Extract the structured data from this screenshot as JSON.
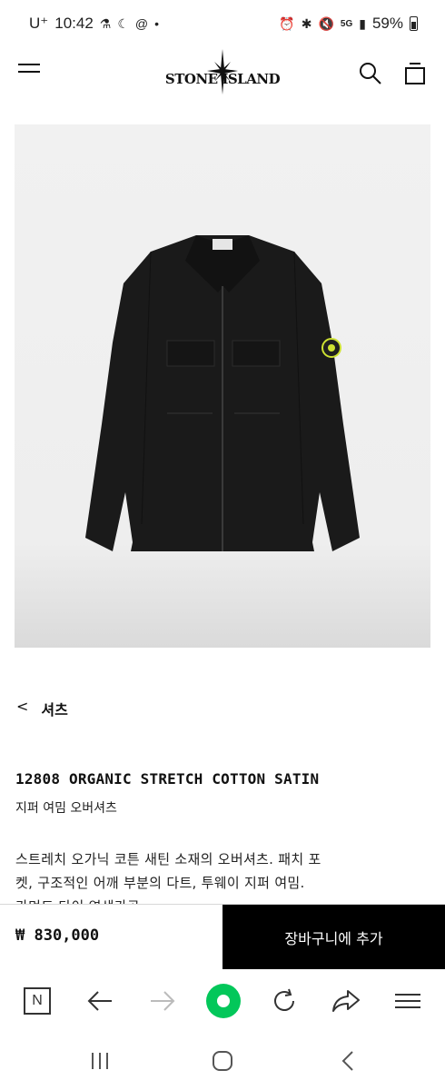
{
  "status_bar": {
    "carrier": "U⁺",
    "time": "10:42",
    "battery": "59%",
    "network": "5G",
    "left_icons": [
      "app-notification-icon",
      "moon-icon",
      "threads-icon",
      "dot-icon"
    ],
    "right_icons": [
      "alarm-icon",
      "bluetooth-icon",
      "mute-icon",
      "signal-icon",
      "battery-icon"
    ]
  },
  "header": {
    "logo_text": "STONE ISLAND",
    "icons": [
      "menu-icon",
      "stone-island-star-logo",
      "search-icon",
      "shopping-bag-icon"
    ]
  },
  "product": {
    "image_alt_icon": "black-overshirt-image",
    "breadcrumb_arrow": "<",
    "breadcrumb_label": "셔츠",
    "title": "12808 ORGANIC STRETCH COTTON SATIN",
    "subtitle": "지퍼 여밈 오버셔츠",
    "description_line1": "스트레치 오가닉 코튼 새틴 소재의 오버셔츠. 패치 포",
    "description_line2": "켓, 구조적인 어깨 부분의 다트, 투웨이 지퍼 여밈.",
    "description_line3": "가먼트 다이 염색가공"
  },
  "purchase": {
    "price": "₩ 830,000",
    "add_to_cart_label": "장바구니에 추가"
  },
  "browser_toolbar": {
    "home_label": "N",
    "icons": [
      "naver-home-icon",
      "back-arrow-icon",
      "forward-arrow-icon",
      "green-dot-icon",
      "refresh-icon",
      "share-icon",
      "menu-icon"
    ]
  },
  "system_nav": {
    "icons": [
      "recent-apps-icon",
      "home-icon",
      "back-icon"
    ]
  },
  "colors": {
    "accent": "#000000",
    "green": "#03c75a",
    "patch": "#cde132"
  }
}
